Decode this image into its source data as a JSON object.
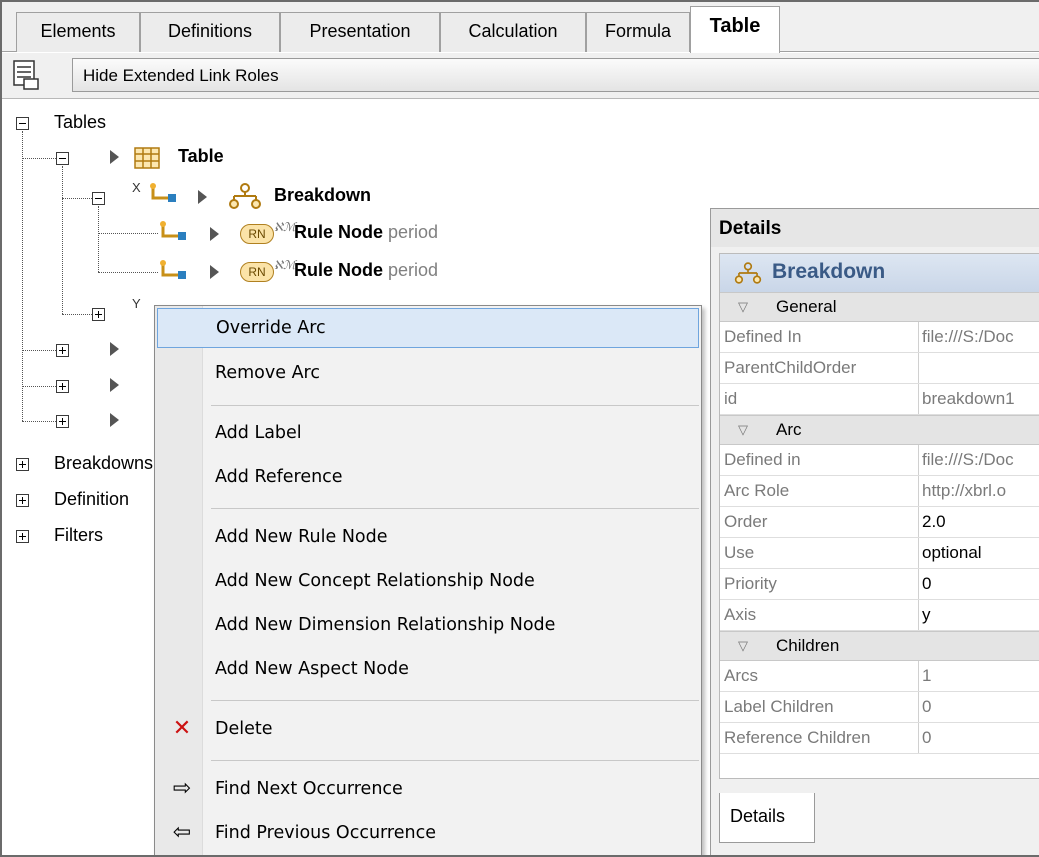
{
  "tabs": [
    {
      "label": "Elements"
    },
    {
      "label": "Definitions"
    },
    {
      "label": "Presentation"
    },
    {
      "label": "Calculation"
    },
    {
      "label": "Formula"
    },
    {
      "label": "Table",
      "active": true
    }
  ],
  "toolbar": {
    "hide_roles_label": "Hide Extended Link Roles",
    "icon": "link-roles-icon"
  },
  "tree": {
    "tables_label": "Tables",
    "table_label": "Table",
    "axis_x": "X",
    "axis_y": "Y",
    "breakdown_label": "Breakdown",
    "rule_node_badge": "RN",
    "rule_node_1": {
      "name": "Rule Node",
      "suffix": "period"
    },
    "rule_node_2": {
      "name": "Rule Node",
      "suffix": "period"
    },
    "breakdowns_label": "Breakdowns",
    "definition_label": "Definition",
    "filters_label": "Filters"
  },
  "context_menu": {
    "items": [
      {
        "label": "Override Arc",
        "highlighted": true
      },
      {
        "label": "Remove Arc"
      },
      {
        "label": "Add Label"
      },
      {
        "label": "Add Reference"
      },
      {
        "label": "Add New Rule Node"
      },
      {
        "label": "Add New Concept Relationship Node"
      },
      {
        "label": "Add New Dimension Relationship Node"
      },
      {
        "label": "Add New Aspect Node"
      },
      {
        "label": "Delete",
        "icon": "delete-icon"
      },
      {
        "label": "Find Next Occurrence",
        "icon": "arrow-right-icon"
      },
      {
        "label": "Find Previous Occurrence",
        "icon": "arrow-left-icon"
      }
    ]
  },
  "details": {
    "title": "Details",
    "header": "Breakdown",
    "sections": {
      "general": "General",
      "arc": "Arc",
      "children": "Children"
    },
    "general_rows": [
      {
        "key": "Defined In",
        "value": "file:///S:/Doc"
      },
      {
        "key": "ParentChildOrder",
        "value": ""
      },
      {
        "key": "id",
        "value": "breakdown1"
      }
    ],
    "arc_rows": [
      {
        "key": "Defined in",
        "value": "file:///S:/Doc"
      },
      {
        "key": "Arc Role",
        "value": "http://xbrl.o"
      },
      {
        "key": "Order",
        "value": "2.0"
      },
      {
        "key": "Use",
        "value": "optional"
      },
      {
        "key": "Priority",
        "value": "0"
      },
      {
        "key": "Axis",
        "value": "y"
      }
    ],
    "children_rows": [
      {
        "key": "Arcs",
        "value": "1"
      },
      {
        "key": "Label Children",
        "value": "0"
      },
      {
        "key": "Reference Children",
        "value": "0"
      }
    ],
    "bottom_tab": "Details"
  }
}
